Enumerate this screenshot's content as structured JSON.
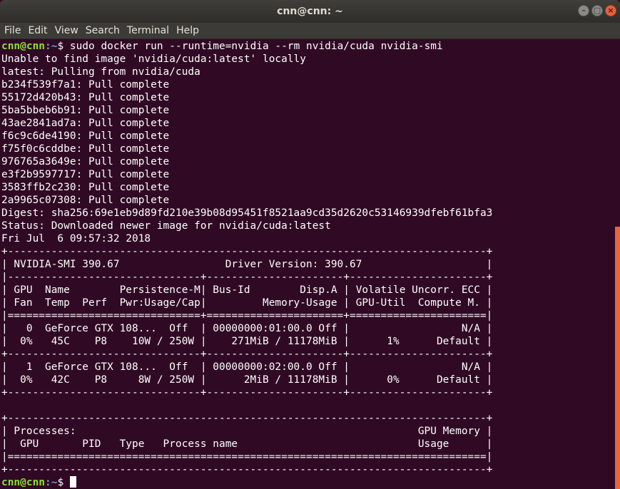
{
  "window": {
    "title": "cnn@cnn: ~",
    "min_glyph": "–",
    "max_glyph": "□",
    "close_glyph": "×"
  },
  "menubar": [
    "File",
    "Edit",
    "View",
    "Search",
    "Terminal",
    "Help"
  ],
  "prompt": {
    "user": "cnn@cnn",
    "path": ":~",
    "symbol": "$ "
  },
  "terminal": {
    "command": "sudo docker run --runtime=nvidia --rm nvidia/cuda nvidia-smi",
    "output": [
      "Unable to find image 'nvidia/cuda:latest' locally",
      "latest: Pulling from nvidia/cuda",
      "b234f539f7a1: Pull complete",
      "55172d420b43: Pull complete",
      "5ba5bbeb6b91: Pull complete",
      "43ae2841ad7a: Pull complete",
      "f6c9c6de4190: Pull complete",
      "f75f0c6cddbe: Pull complete",
      "976765a3649e: Pull complete",
      "e3f2b9597717: Pull complete",
      "3583ffb2c230: Pull complete",
      "2a9965c07308: Pull complete",
      "Digest: sha256:69e1eb9d89fd210e39b08d95451f8521aa9cd35d2620c53146939dfebf61bfa3",
      "Status: Downloaded newer image for nvidia/cuda:latest",
      "Fri Jul  6 09:57:32 2018",
      "+-----------------------------------------------------------------------------+",
      "| NVIDIA-SMI 390.67                 Driver Version: 390.67                    |",
      "|-------------------------------+----------------------+----------------------+",
      "| GPU  Name        Persistence-M| Bus-Id        Disp.A | Volatile Uncorr. ECC |",
      "| Fan  Temp  Perf  Pwr:Usage/Cap|         Memory-Usage | GPU-Util  Compute M. |",
      "|===============================+======================+======================|",
      "|   0  GeForce GTX 108...  Off  | 00000000:01:00.0 Off |                  N/A |",
      "|  0%   45C    P8    10W / 250W |    271MiB / 11178MiB |      1%      Default |",
      "+-------------------------------+----------------------+----------------------+",
      "|   1  GeForce GTX 108...  Off  | 00000000:02:00.0 Off |                  N/A |",
      "|  0%   42C    P8     8W / 250W |      2MiB / 11178MiB |      0%      Default |",
      "+-------------------------------+----------------------+----------------------+",
      "",
      "+-----------------------------------------------------------------------------+",
      "| Processes:                                                       GPU Memory |",
      "|  GPU       PID   Type   Process name                             Usage      |",
      "|=============================================================================|",
      "+-----------------------------------------------------------------------------+"
    ]
  },
  "colors": {
    "background": "#300a24",
    "prompt_user": "#8ae234",
    "prompt_path": "#729fcf",
    "scrollbar": "#e9643a"
  }
}
